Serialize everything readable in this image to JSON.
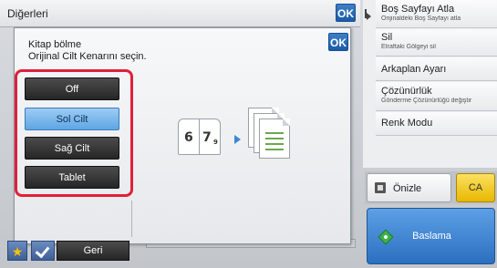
{
  "header": {
    "title": "Diğerleri",
    "ok_label": "OK"
  },
  "dialog": {
    "title_line1": "Kitap bölme",
    "title_line2": "Orijinal Cilt Kenarını seçin.",
    "ok_label": "OK",
    "options": [
      {
        "label": "Off",
        "selected": false
      },
      {
        "label": "Sol Cilt",
        "selected": true
      },
      {
        "label": "Sağ Cilt",
        "selected": false
      },
      {
        "label": "Tablet",
        "selected": false
      }
    ],
    "illustration": {
      "page_left": "6",
      "page_right": "7",
      "page_sub": "9"
    }
  },
  "right_panel": {
    "items": [
      {
        "label": "Boş Sayfayı Atla",
        "sub": "Orijinaldeki Boş Sayfayı atla"
      },
      {
        "label": "Sil",
        "sub": "Etraftaki Gölgeyi sil"
      },
      {
        "label": "Arkaplan Ayarı",
        "sub": ""
      },
      {
        "label": "Çözünürlük",
        "sub": "Gönderme Çözünürlüğü değiştir"
      },
      {
        "label": "Renk Modu",
        "sub": ""
      }
    ]
  },
  "actions": {
    "preview_label": "Önizle",
    "ca_label": "CA",
    "start_label": "Baslama"
  },
  "bottom": {
    "back_label": "Geri",
    "star_icon": "★"
  },
  "colors": {
    "highlight": "#e0203a",
    "selected": "#6eb0ea",
    "accent_blue": "#2c6fc0",
    "ca_yellow": "#f2c400"
  }
}
